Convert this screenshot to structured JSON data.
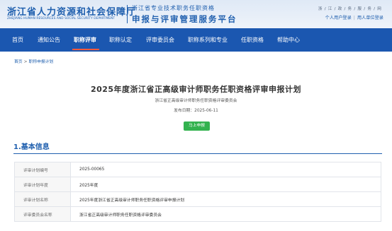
{
  "header": {
    "logo_main": "浙江省人力资源和社会保障厅",
    "logo_en": "ZHEJIANG HUMAN RESOURCES AND SOCIAL SECURITY DEPARTMENT",
    "system_subtitle": "浙江省专业技术职务任职资格",
    "system_title": "申报与评审管理服务平台",
    "site_tag": "浙/江/政/务/服/务/网",
    "personal_login": "个人用户登录",
    "separator": "|",
    "org_login": "用人单位登录"
  },
  "nav": {
    "items": [
      {
        "label": "首页"
      },
      {
        "label": "通知公告"
      },
      {
        "label": "职称评审"
      },
      {
        "label": "职称认定"
      },
      {
        "label": "评审委员会"
      },
      {
        "label": "职称系列和专业"
      },
      {
        "label": "任职资格"
      },
      {
        "label": "帮助中心"
      }
    ],
    "active_index": 2
  },
  "breadcrumb": {
    "home": "首页",
    "arrow": ">",
    "current": "职称申报计划"
  },
  "plan": {
    "title": "2025年度浙江省正高级审计师职务任职资格评审申报计划",
    "publisher": "浙江省正高级审计师职务任职资格评审委员会",
    "publish_date": "发布日期：2025-06-11",
    "apply_button": "马上申报"
  },
  "section": {
    "title": "1.基本信息"
  },
  "basic_info": [
    {
      "label": "评审计划编号",
      "value": "2025-00065"
    },
    {
      "label": "评审计划年度",
      "value": "2025年度"
    },
    {
      "label": "评审计划名称",
      "value": "2025年度浙江省正高级审计师职务任职资格评审申报计划"
    },
    {
      "label": "评审委员会名称",
      "value": "浙江省正高级审计师职务任职资格评审委员会"
    }
  ],
  "colors": {
    "nav_bg": "#1b57b0",
    "brand_blue": "#1f5fae",
    "active_underline": "#ff5a3c",
    "apply_green": "#33b24f"
  }
}
